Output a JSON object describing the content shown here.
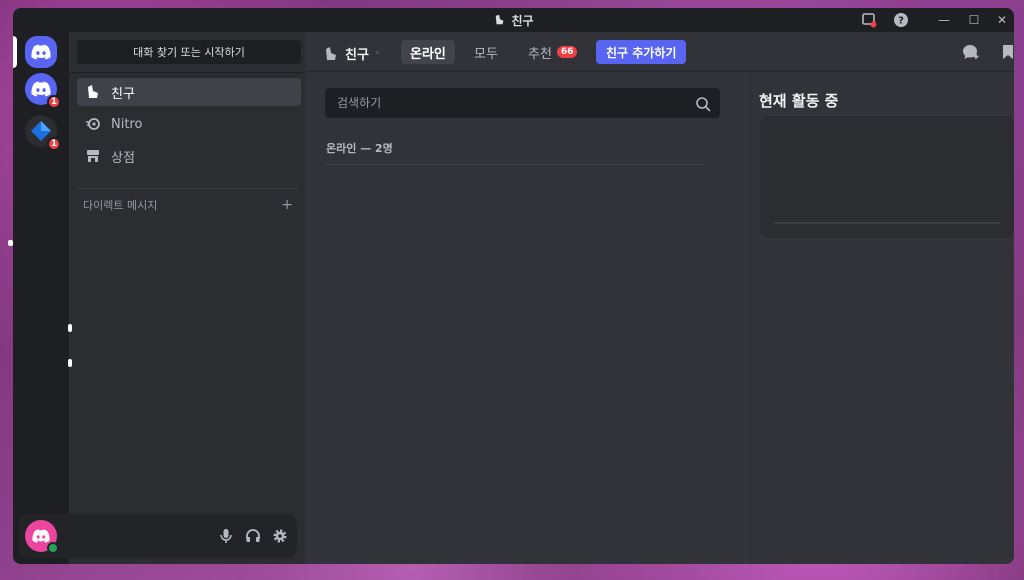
{
  "window": {
    "title": "친구",
    "controls": {
      "minimize": "—",
      "maximize": "☐",
      "close": "✕"
    }
  },
  "servers": [
    {
      "name": "home",
      "icon": "discord-logo-icon",
      "badge": ""
    },
    {
      "name": "server-2",
      "icon": "discord-logo-icon",
      "badge": "1"
    },
    {
      "name": "server-3",
      "icon": "diamond-logo-icon",
      "badge": "1"
    }
  ],
  "sidebar": {
    "search_button": "대화 찾기 또는 시작하기",
    "items": [
      {
        "label": "친구",
        "icon": "friends-icon",
        "active": true
      },
      {
        "label": "Nitro",
        "icon": "nitro-icon",
        "active": false
      },
      {
        "label": "상점",
        "icon": "shop-icon",
        "active": false
      }
    ],
    "dm_header": "다이렉트 메시지",
    "dm_add": "+"
  },
  "header": {
    "title": "친구",
    "tabs": [
      {
        "label": "온라인",
        "active": true
      },
      {
        "label": "모두",
        "active": false
      },
      {
        "label": "추천",
        "active": false,
        "count": "66"
      }
    ],
    "add_friend": "친구 추가하기"
  },
  "friends": {
    "search_placeholder": "검색하기",
    "online_count": "온라인 — 2명"
  },
  "active_now": {
    "title": "현재 활동 중"
  },
  "colors": {
    "blurple": "#5865f2",
    "danger": "#f23f43",
    "online": "#23a559",
    "avatar": "#eb459e"
  }
}
